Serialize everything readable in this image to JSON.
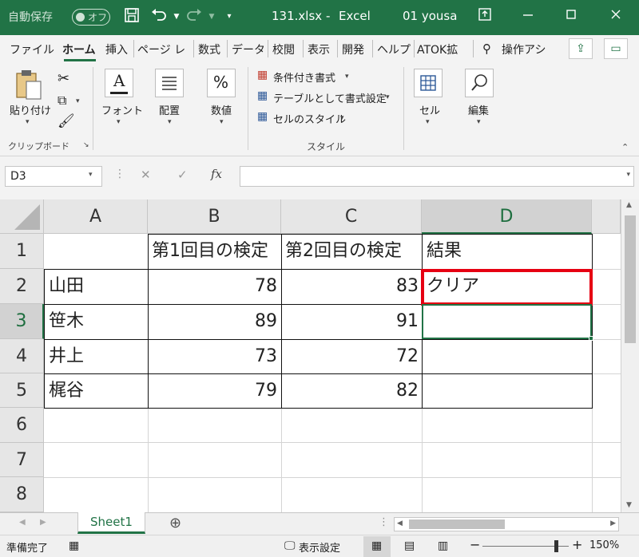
{
  "titlebar": {
    "autosave_label": "自動保存",
    "autosave_state": "オフ",
    "filename": "131.xlsx",
    "separator": "-",
    "app_name": "Excel",
    "user": "01 yousa"
  },
  "tabs": [
    "ファイル",
    "ホーム",
    "挿入",
    "ページ レ",
    "数式",
    "データ",
    "校閲",
    "表示",
    "開発",
    "ヘルプ",
    "ATOK拡",
    "操作アシ"
  ],
  "ribbon": {
    "paste_label": "貼り付け",
    "clipboard_group": "クリップボード",
    "font_label": "フォント",
    "alignment_label": "配置",
    "number_label": "数値",
    "conditional_format": "条件付き書式",
    "format_as_table": "テーブルとして書式設定",
    "cell_styles": "セルのスタイル",
    "styles_group": "スタイル",
    "cells_label": "セル",
    "editing_label": "編集",
    "number_icon": "%",
    "font_icon": "A"
  },
  "formula_bar": {
    "name_box": "D3",
    "cancel_icon": "✕",
    "enter_icon": "✓",
    "fx_label": "fx",
    "value": ""
  },
  "columns": [
    "A",
    "B",
    "C",
    "D"
  ],
  "rows": [
    "1",
    "2",
    "3",
    "4",
    "5",
    "6",
    "7",
    "8"
  ],
  "table": {
    "headers": [
      "",
      "第1回目の検定",
      "第2回目の検定",
      "結果"
    ],
    "rows": [
      {
        "name": "山田",
        "first": "78",
        "second": "83",
        "result": "クリア"
      },
      {
        "name": "笹木",
        "first": "89",
        "second": "91",
        "result": ""
      },
      {
        "name": "井上",
        "first": "73",
        "second": "72",
        "result": ""
      },
      {
        "name": "梶谷",
        "first": "79",
        "second": "82",
        "result": ""
      }
    ]
  },
  "sheet_tab": "Sheet1",
  "status": {
    "ready": "準備完了",
    "display_settings": "表示設定",
    "zoom": "150%",
    "zoom_minus": "−",
    "zoom_plus": "+"
  },
  "colors": {
    "excel_green": "#217346",
    "highlight_red": "#e60012"
  }
}
